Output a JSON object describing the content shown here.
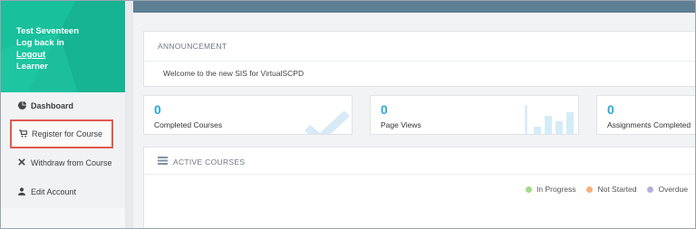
{
  "user": {
    "name": "Test Seventeen",
    "log_back": "Log back in",
    "logout": "Logout",
    "role": "Learner"
  },
  "menu": {
    "items": [
      {
        "label": "Dashboard",
        "icon": "pie-chart-icon"
      },
      {
        "label": "Register for Course",
        "icon": "cart-icon"
      },
      {
        "label": "Withdraw from Course",
        "icon": "close-icon"
      },
      {
        "label": "Edit Account",
        "icon": "user-icon"
      }
    ]
  },
  "announcement": {
    "title": "ANNOUNCEMENT",
    "message": "Welcome to the new SIS for VirtualSCPD"
  },
  "stats": [
    {
      "value": "0",
      "label": "Completed Courses"
    },
    {
      "value": "0",
      "label": "Page Views"
    },
    {
      "value": "0",
      "label": "Assignments Completed"
    }
  ],
  "active_courses": {
    "title": "ACTIVE COURSES",
    "legend": [
      {
        "label": "In Progress",
        "color": "#a6d98a"
      },
      {
        "label": "Not Started",
        "color": "#f3b07a"
      },
      {
        "label": "Overdue",
        "color": "#b6aee0"
      }
    ]
  },
  "colors": {
    "brand_green": "#19c09c",
    "topbar": "#5f7f95",
    "stat_blue": "#27a9d8",
    "highlight_border": "#e05a4e"
  }
}
